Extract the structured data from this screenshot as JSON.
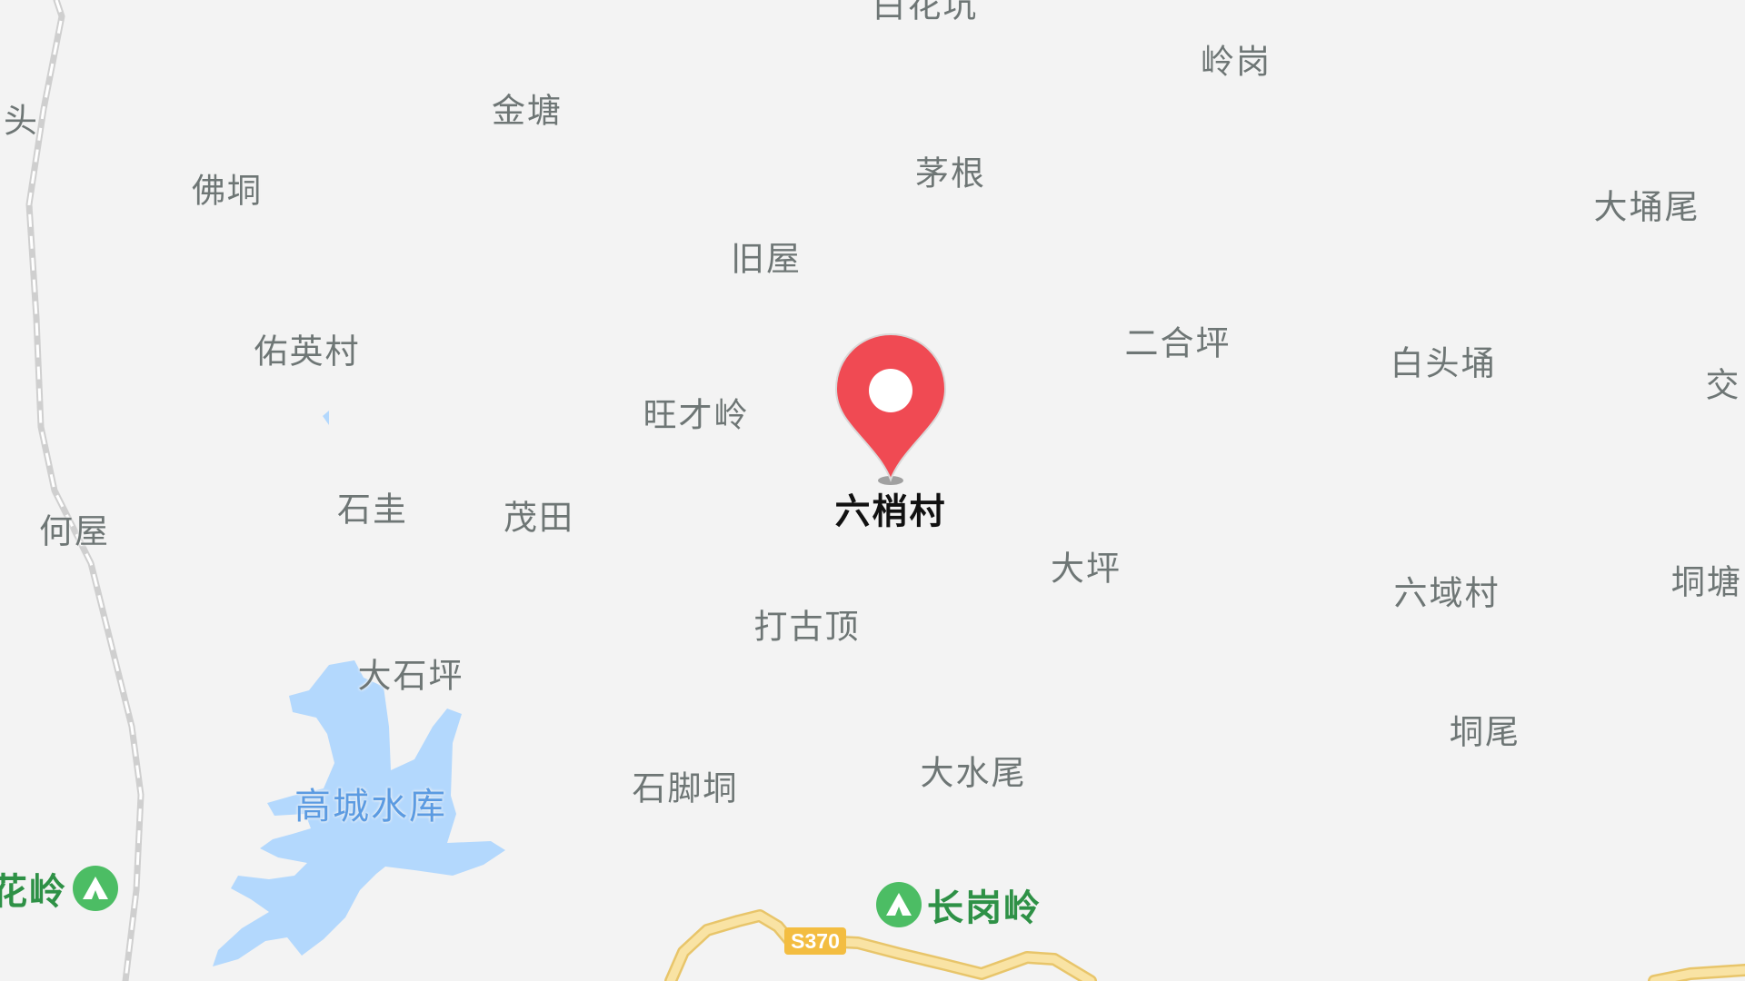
{
  "map": {
    "selected_place": "六梢村",
    "lake": "高城水库",
    "road_badge": "S370",
    "colors": {
      "background": "#f3f3f3",
      "water": "#b3d8fd",
      "road": "#f7da8c",
      "pin": "#f04a53",
      "place_label": "#6e7675",
      "peak_label": "#2e9146"
    },
    "places": [
      "白花坑",
      "岭岗",
      "金塘",
      "洲头",
      "佛垌",
      "茅根",
      "大埇尾",
      "旧屋",
      "二合坪",
      "佑英村",
      "白头埇",
      "交",
      "旺才岭",
      "何屋",
      "石圭",
      "茂田",
      "大坪",
      "六域村",
      "垌塘",
      "打古顶",
      "大石坪",
      "垌尾",
      "大水尾",
      "石脚垌"
    ],
    "peaks": [
      "长岗岭",
      "花岭"
    ]
  }
}
